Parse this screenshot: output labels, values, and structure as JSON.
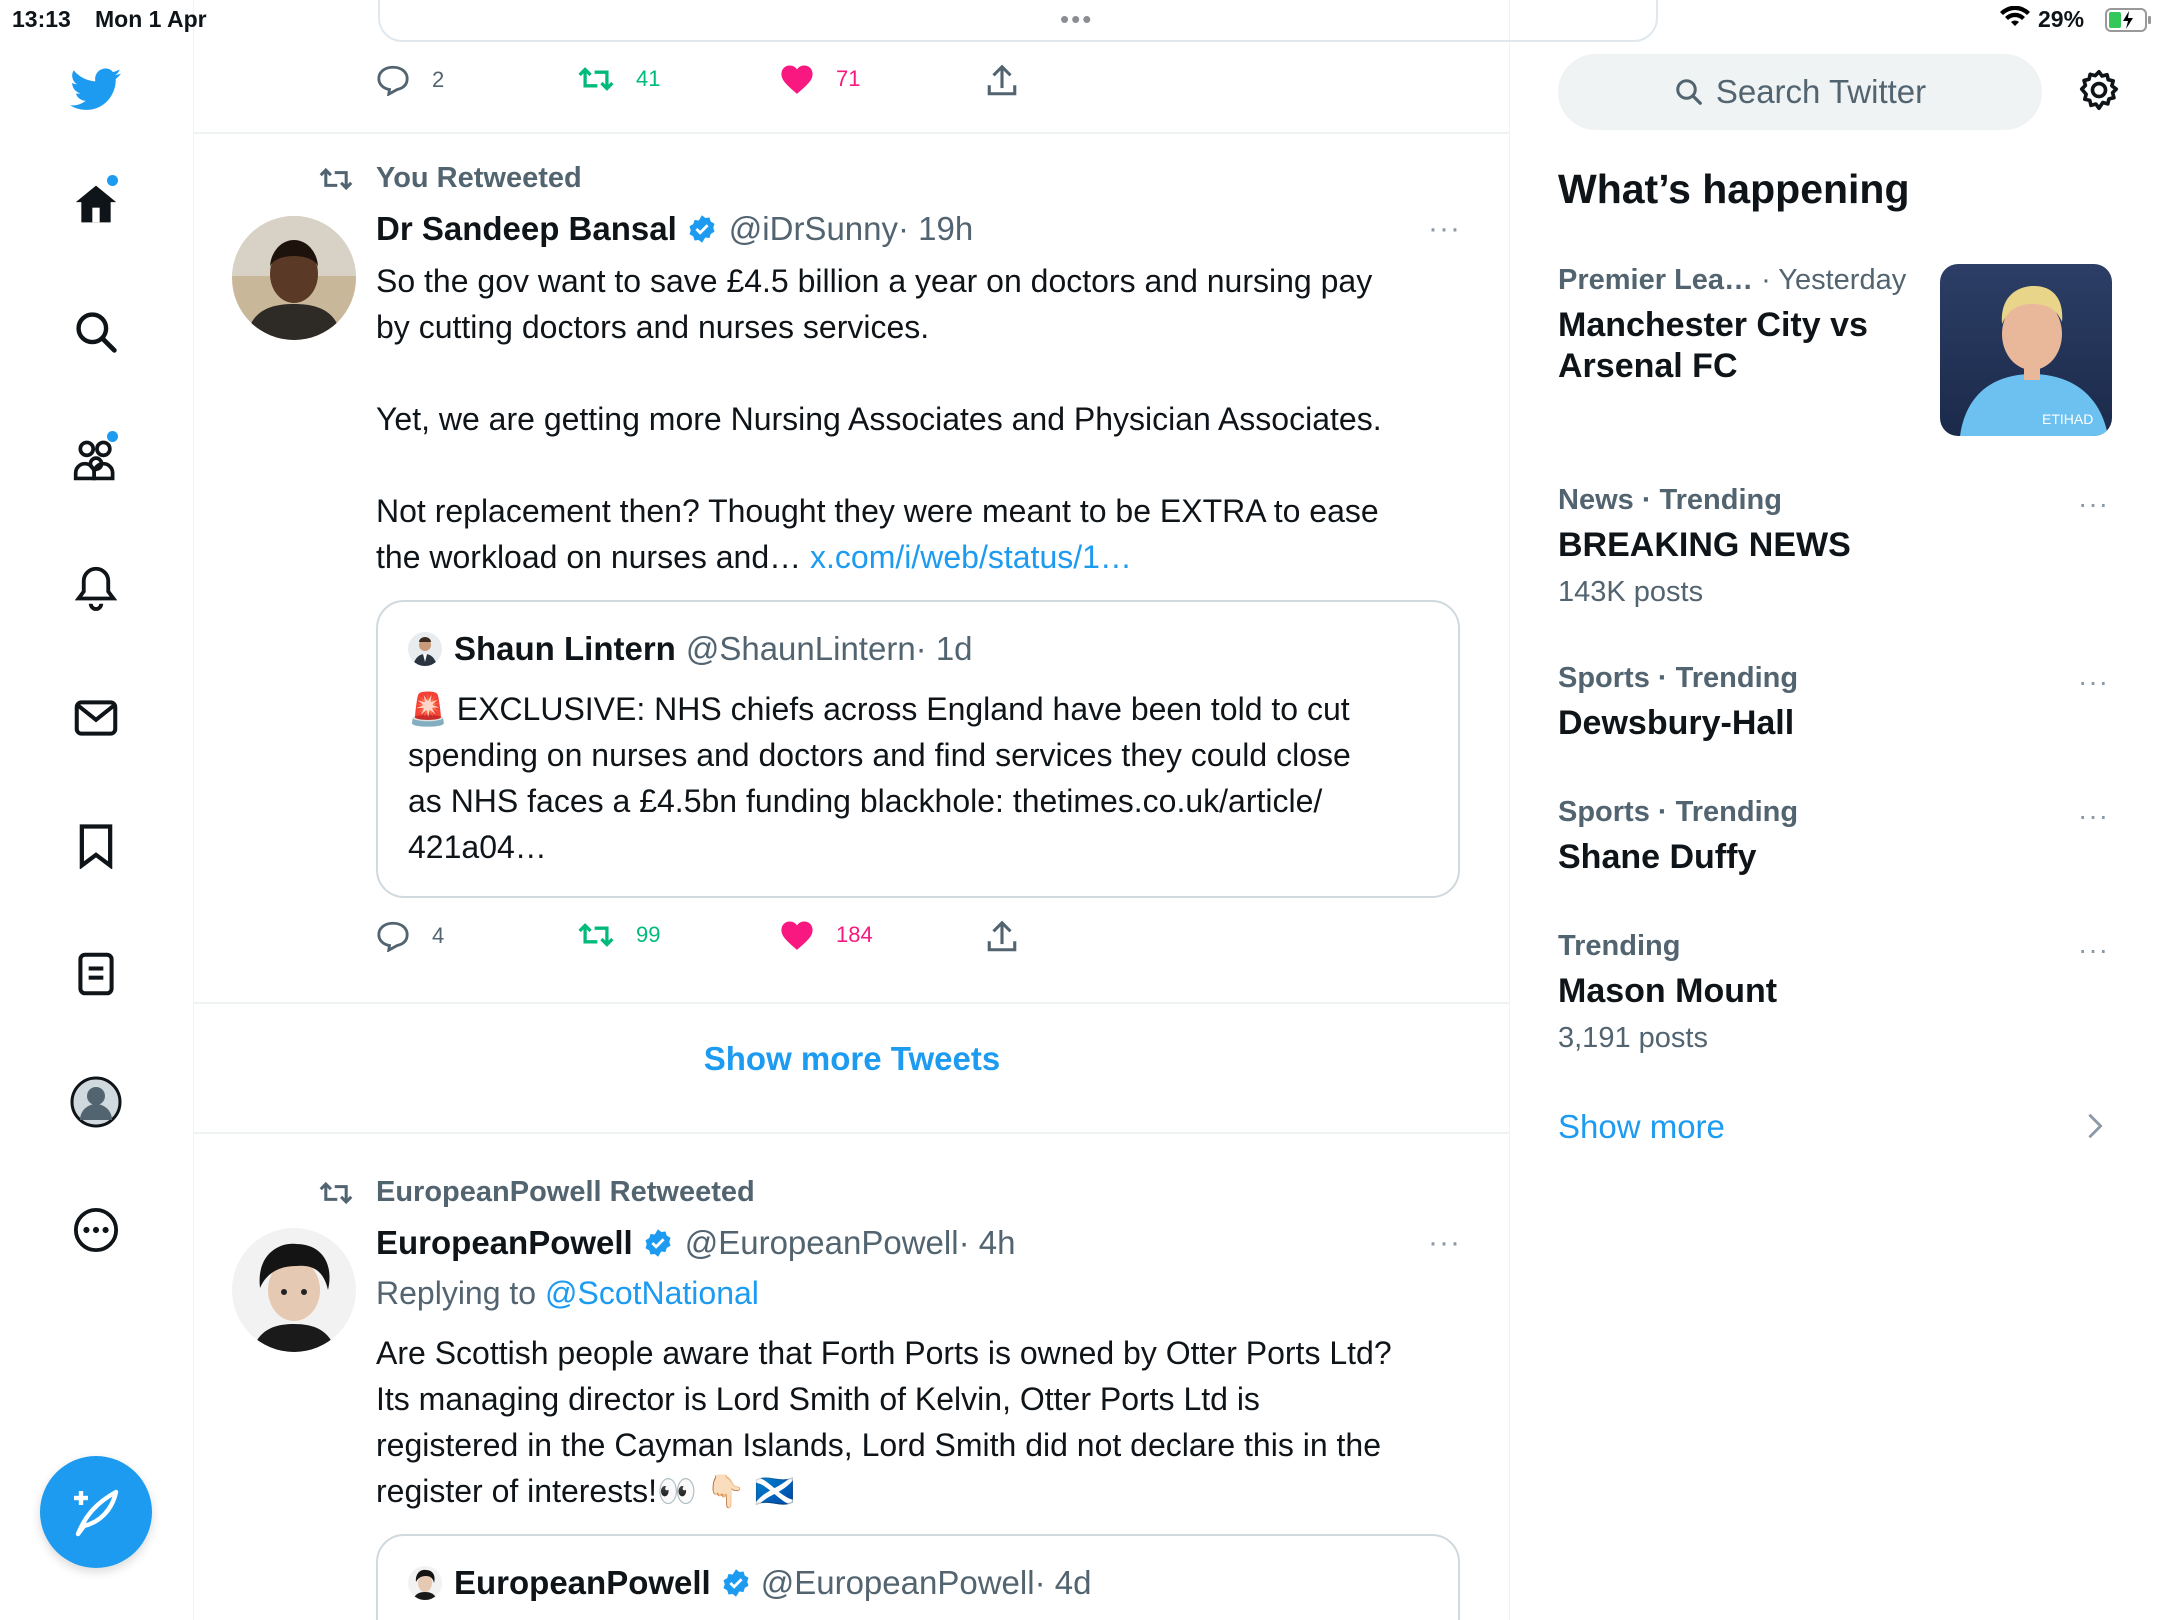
{
  "status_bar": {
    "time": "13:13",
    "date": "Mon 1 Apr",
    "battery": "29%",
    "multitask_dots": "•••"
  },
  "nav": {
    "items": [
      "twitter-logo",
      "home",
      "search",
      "communities",
      "notifications",
      "messages",
      "bookmarks",
      "lists",
      "profile",
      "more"
    ],
    "accent": "#1d9bf0"
  },
  "feed": {
    "top_tweet_actions": {
      "replies": "2",
      "retweets": "41",
      "likes": "71"
    },
    "tweet1": {
      "retweet_label": "You Retweeted",
      "name": "Dr Sandeep Bansal",
      "handle": "@iDrSunny",
      "time": "· 19h",
      "more": "···",
      "text": "So the gov want to save £4.5 billion a year on doctors and nursing pay\nby cutting doctors and nurses services.\n\nYet, we are getting more Nursing Associates and Physician Associates.\n\nNot replacement then? Thought they were meant to be EXTRA to ease\nthe workload on nurses and… ",
      "link": "x.com/i/web/status/1…",
      "quote": {
        "name": "Shaun Lintern",
        "handle": "@ShaunLintern",
        "time": "· 1d",
        "emoji": "🚨",
        "text": " EXCLUSIVE: NHS chiefs across England have been told to cut\nspending on nurses and doctors and find services they could close\nas NHS faces a £4.5bn funding blackhole: thetimes.co.uk/article/\n421a04…"
      },
      "actions": {
        "replies": "4",
        "retweets": "99",
        "likes": "184"
      }
    },
    "show_more_tweets": "Show more Tweets",
    "tweet2": {
      "retweet_label": "EuropeanPowell Retweeted",
      "name": "EuropeanPowell",
      "handle": "@EuropeanPowell",
      "time": "· 4h",
      "more": "···",
      "replying_prefix": "Replying to ",
      "replying_to": "@ScotNational",
      "text": "Are Scottish people aware that Forth Ports is owned by Otter Ports Ltd?\nIts managing director is Lord Smith of Kelvin, Otter Ports Ltd is\nregistered in the Cayman Islands, Lord Smith did not declare this in the\nregister of interests!👀 👇🏻 🏴󠁧󠁢󠁳󠁣󠁴󠁿",
      "quote": {
        "name": "EuropeanPowell",
        "handle": "@EuropeanPowell",
        "time": "· 4d"
      }
    }
  },
  "sidebar": {
    "search_placeholder": "Search Twitter",
    "title": "What’s happening",
    "trends": [
      {
        "category": "Premier Lea…",
        "when": " · Yesterday",
        "topic": "Manchester City vs\nArsenal FC"
      },
      {
        "category": "News · Trending",
        "topic": "BREAKING NEWS",
        "count": "143K posts",
        "more": "···"
      },
      {
        "category": "Sports · Trending",
        "topic": "Dewsbury-Hall",
        "more": "···"
      },
      {
        "category": "Sports · Trending",
        "topic": "Shane Duffy",
        "more": "···"
      },
      {
        "category": "Trending",
        "topic": "Mason Mount",
        "count": "3,191 posts",
        "more": "···"
      }
    ],
    "show_more": "Show more"
  }
}
